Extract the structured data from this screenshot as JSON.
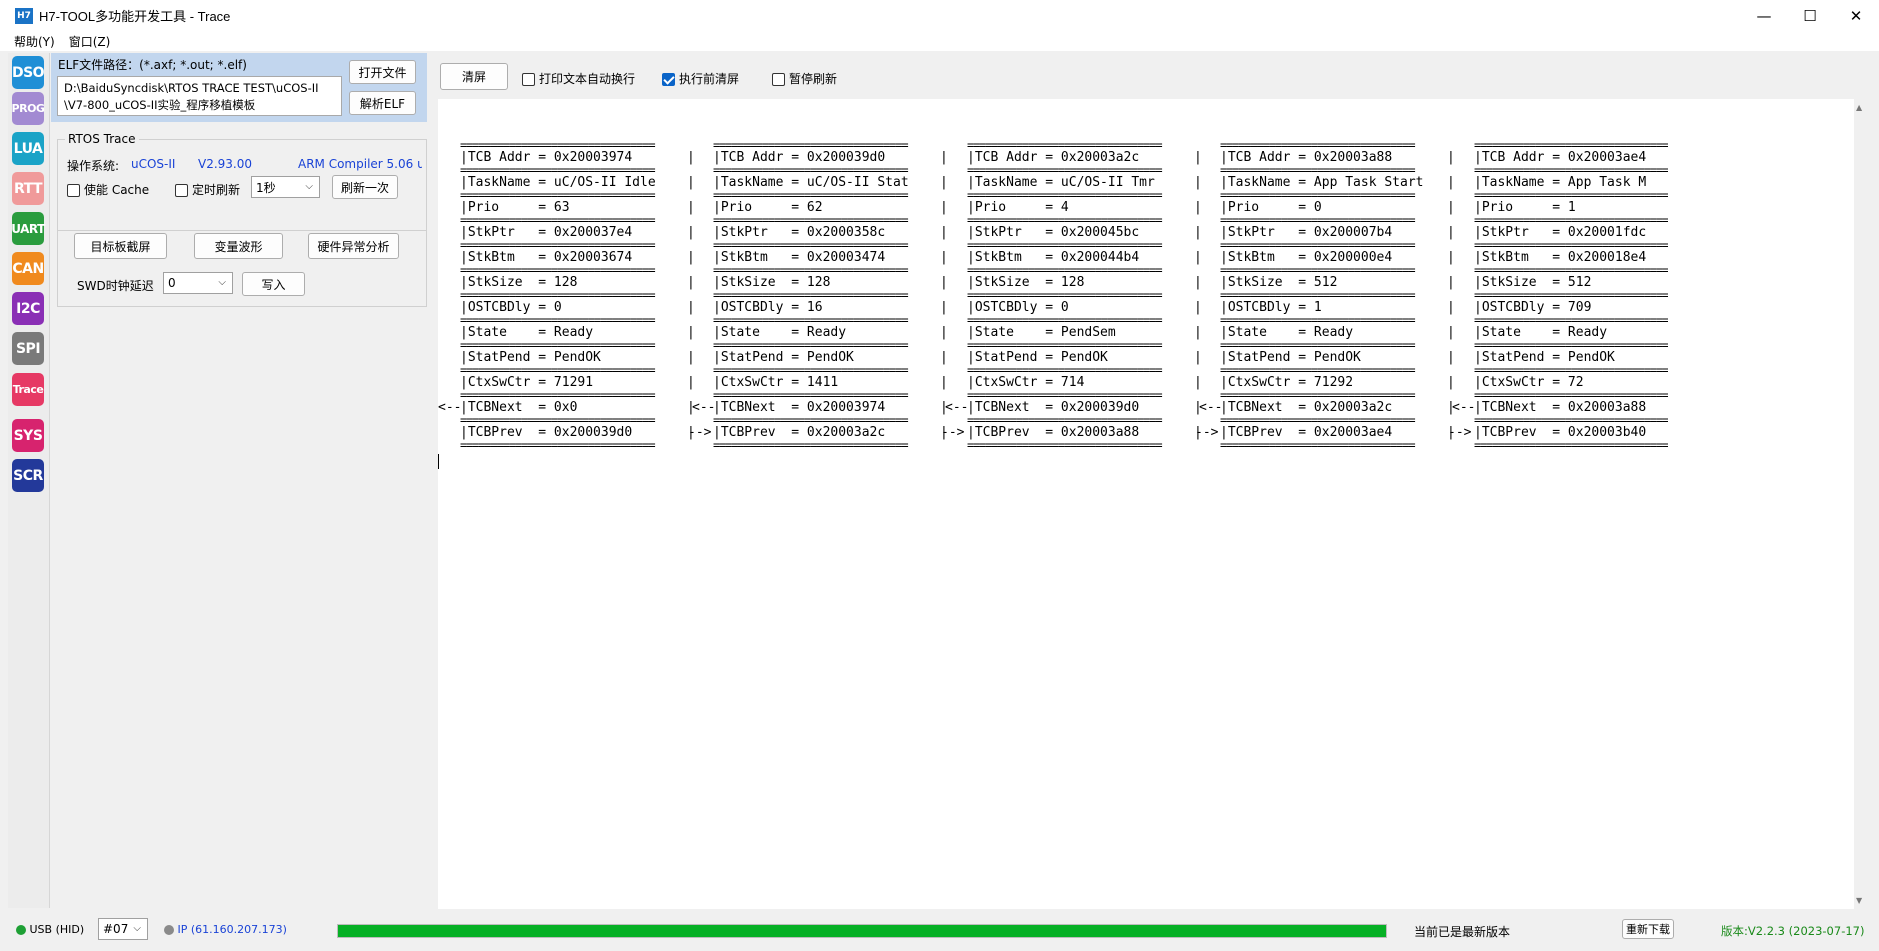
{
  "window": {
    "icon_text": "H7",
    "title": "H7-TOOL多功能开发工具 - Trace",
    "minimize": "—",
    "maximize": "☐",
    "close": "✕"
  },
  "menu": [
    "帮助(Y)",
    "窗口(Z)"
  ],
  "tools": [
    {
      "label": "DSO",
      "color": "#1f8fd6"
    },
    {
      "label": "PROG",
      "color": "#a28ad2"
    },
    {
      "label": "LUA",
      "color": "#1aa3c7"
    },
    {
      "label": "RTT",
      "color": "#f09a9a"
    },
    {
      "label": "UART",
      "color": "#2a9c3e"
    },
    {
      "label": "CAN",
      "color": "#f08a1e"
    },
    {
      "label": "I2C",
      "color": "#8a2fb5"
    },
    {
      "label": "SPI",
      "color": "#7a7a7a"
    },
    {
      "label": "Trace",
      "color": "#e63964"
    },
    {
      "label": "SYS",
      "color": "#d7236e"
    },
    {
      "label": "SCR",
      "color": "#23399a"
    }
  ],
  "elf": {
    "label": "ELF文件路径：(*.axf; *.out; *.elf)",
    "path_line1": "D:\\BaiduSyncdisk\\RTOS TRACE TEST\\uCOS-II",
    "path_line2": "\\V7-800_uCOS-II实验_程序移植模板",
    "open_button": "打开文件",
    "parse_button": "解析ELF"
  },
  "rtos": {
    "group_title": "RTOS Trace",
    "os_label": "操作系统:",
    "os_name": "uCOS-II",
    "os_version": "V2.93.00",
    "compiler": "ARM Compiler 5.06 u",
    "cache_label": "使能 Cache",
    "timer_label": "定时刷新",
    "interval": "1秒",
    "refresh_once": "刷新一次"
  },
  "actions": {
    "screenshot": "目标板截屏",
    "waveform": "变量波形",
    "hardfault": "硬件异常分析",
    "swd_label": "SWD时钟延迟",
    "swd_value": "0",
    "write": "写入"
  },
  "output_toolbar": {
    "clear": "清屏",
    "wrap_label": "打印文本自动换行",
    "clear_before_label": "执行前清屏",
    "pause_label": "暂停刷新",
    "wrap_checked": false,
    "clear_before_checked": true,
    "pause_checked": false
  },
  "tcb": {
    "separator": "================================",
    "tasks": [
      {
        "rows": [
          "|TCB Addr = 0x20003974       |",
          "|TaskName = uC/OS-II Idle    |",
          "|Prio     = 63               |",
          "|StkPtr   = 0x200037e4       |",
          "|StkBtm   = 0x20003674       |",
          "|StkSize  = 128              |",
          "|OSTCBDly = 0                |",
          "|State    = Ready            |",
          "|StatPend = PendOK           |",
          "|CtxSwCtr = 71291            |",
          "|TCBNext  = 0x0              |",
          "|TCBPrev  = 0x200039d0       |"
        ]
      },
      {
        "rows": [
          "|TCB Addr = 0x200039d0       |",
          "|TaskName = uC/OS-II Stat    |",
          "|Prio     = 62               |",
          "|StkPtr   = 0x2000358c       |",
          "|StkBtm   = 0x20003474       |",
          "|StkSize  = 128              |",
          "|OSTCBDly = 16               |",
          "|State    = Ready            |",
          "|StatPend = PendOK           |",
          "|CtxSwCtr = 1411             |",
          "|TCBNext  = 0x20003974       |",
          "|TCBPrev  = 0x20003a2c       |"
        ]
      },
      {
        "rows": [
          "|TCB Addr = 0x20003a2c       |",
          "|TaskName = uC/OS-II Tmr     |",
          "|Prio     = 4                |",
          "|StkPtr   = 0x200045bc       |",
          "|StkBtm   = 0x200044b4       |",
          "|StkSize  = 128              |",
          "|OSTCBDly = 0                |",
          "|State    = PendSem          |",
          "|StatPend = PendOK           |",
          "|CtxSwCtr = 714              |",
          "|TCBNext  = 0x200039d0       |",
          "|TCBPrev  = 0x20003a88       |"
        ]
      },
      {
        "rows": [
          "|TCB Addr = 0x20003a88       |",
          "|TaskName = App Task Start   |",
          "|Prio     = 0                |",
          "|StkPtr   = 0x200007b4       |",
          "|StkBtm   = 0x200000e4       |",
          "|StkSize  = 512              |",
          "|OSTCBDly = 1                |",
          "|State    = Ready            |",
          "|StatPend = PendOK           |",
          "|CtxSwCtr = 71292            |",
          "|TCBNext  = 0x20003a2c       |",
          "|TCBPrev  = 0x20003ae4       |"
        ]
      },
      {
        "rows": [
          "|TCB Addr = 0x20003ae4",
          "|TaskName = App Task M",
          "|Prio     = 1",
          "|StkPtr   = 0x20001fdc",
          "|StkBtm   = 0x200018e4",
          "|StkSize  = 512",
          "|OSTCBDly = 709",
          "|State    = Ready",
          "|StatPend = PendOK",
          "|CtxSwCtr = 72",
          "|TCBNext  = 0x20003a88",
          "|TCBPrev  = 0x20003b40"
        ]
      }
    ],
    "arrow_left": "<--",
    "arrow_right": "-->"
  },
  "status": {
    "usb_label": "USB (HID)",
    "device_no": "#07",
    "ip_label": "IP (61.160.207.173)",
    "progress": 1.0,
    "update_text": "当前已是最新版本",
    "redownload": "重新下载",
    "version": "版本:V2.2.3 (2023-07-17)"
  }
}
